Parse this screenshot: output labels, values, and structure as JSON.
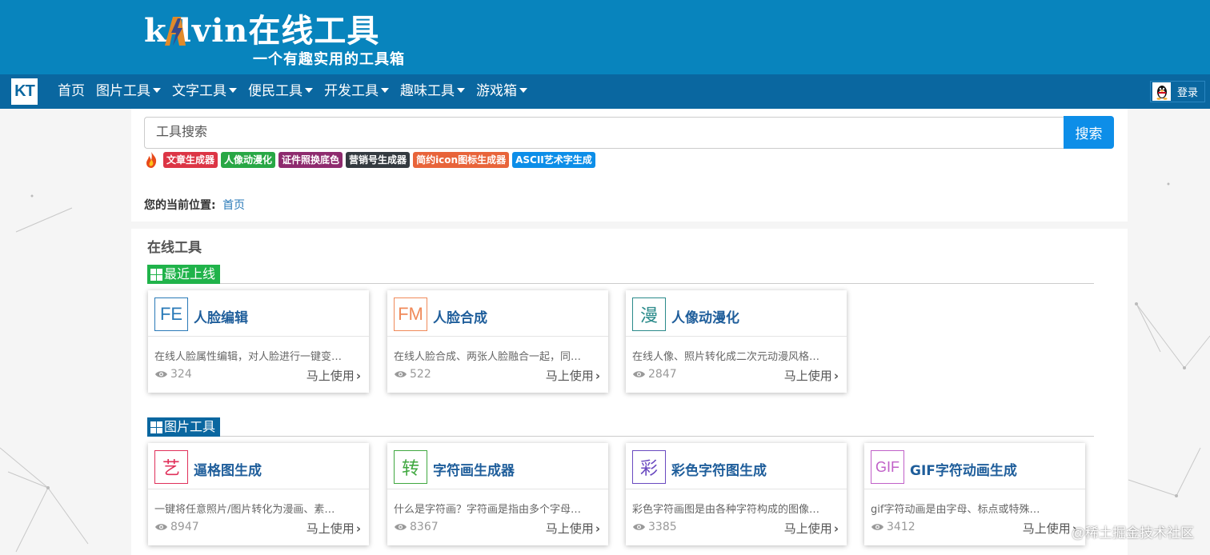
{
  "header": {
    "logo_text": "k  lvin在线工具",
    "slogan": "一个有趣实用的工具箱",
    "colors": {
      "banner": "#0884bd",
      "navbar": "#0a67a0"
    }
  },
  "nav": {
    "logo": "KT",
    "items": [
      {
        "label": "首页",
        "dropdown": false
      },
      {
        "label": "图片工具",
        "dropdown": true
      },
      {
        "label": "文字工具",
        "dropdown": true
      },
      {
        "label": "便民工具",
        "dropdown": true
      },
      {
        "label": "开发工具",
        "dropdown": true
      },
      {
        "label": "趣味工具",
        "dropdown": true
      },
      {
        "label": "游戏箱",
        "dropdown": true
      }
    ],
    "login_label": "登录",
    "login_icon": "qq-penguin-icon"
  },
  "search": {
    "placeholder": "工具搜索",
    "button_label": "搜索",
    "hot_icon": "fire-icon",
    "hot_tags": [
      {
        "label": "文章生成器",
        "color": "#dc3545"
      },
      {
        "label": "人像动漫化",
        "color": "#28a745"
      },
      {
        "label": "证件照换底色",
        "color": "#8e2b6e"
      },
      {
        "label": "营销号生成器",
        "color": "#343a40"
      },
      {
        "label": "简约icon图标生成器",
        "color": "#e8643a"
      },
      {
        "label": "ASCII艺术字生成",
        "color": "#0d8ee8"
      }
    ]
  },
  "breadcrumb": {
    "label": "您的当前位置:",
    "home": "首页"
  },
  "main": {
    "title": "在线工具",
    "sections": [
      {
        "label": "最近上线",
        "color": "#20b34a",
        "cards": [
          {
            "icon_text": "FE",
            "icon_color": "#2a7ab8",
            "title": "人脸编辑",
            "desc": "在线人脸属性编辑，对人脸进行一键变…",
            "views": "324",
            "use_label": "马上使用"
          },
          {
            "icon_text": "FM",
            "icon_color": "#f08a5a",
            "title": "人脸合成",
            "desc": "在线人脸合成、两张人脸融合一起，同…",
            "views": "522",
            "use_label": "马上使用"
          },
          {
            "icon_text": "漫",
            "icon_color": "#2a8a8a",
            "title": "人像动漫化",
            "desc": "在线人像、照片转化成二次元动漫风格…",
            "views": "2847",
            "use_label": "马上使用"
          }
        ]
      },
      {
        "label": "图片工具",
        "color": "#0a67a0",
        "cards": [
          {
            "icon_text": "艺",
            "icon_color": "#e0305a",
            "title": "逼格图生成",
            "desc": "一键将任意照片/图片转化为漫画、素…",
            "views": "8947",
            "use_label": "马上使用"
          },
          {
            "icon_text": "转",
            "icon_color": "#40a840",
            "title": "字符画生成器",
            "desc": "什么是字符画？字符画是指由多个字母…",
            "views": "8367",
            "use_label": "马上使用"
          },
          {
            "icon_text": "彩",
            "icon_color": "#6a4ac0",
            "title": "彩色字符图生成",
            "desc": "彩色字符画图是由各种字符构成的图像…",
            "views": "3385",
            "use_label": "马上使用"
          },
          {
            "icon_text": "GIF",
            "icon_color": "#c060c8",
            "title": "GIF字符动画生成",
            "desc": "gif字符动画是由字母、标点或特殊…",
            "views": "3412",
            "use_label": "马上使用"
          }
        ]
      }
    ]
  },
  "watermark": "@稀土掘金技术社区"
}
